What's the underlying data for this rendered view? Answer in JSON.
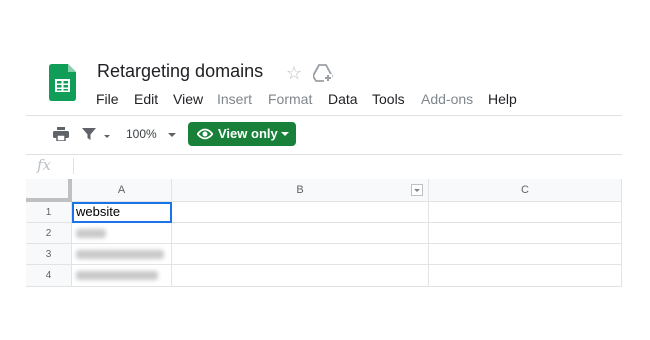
{
  "document": {
    "title": "Retargeting domains"
  },
  "icons": {
    "app": "sheets-logo-icon",
    "star": "star-outline-icon",
    "drive": "move-to-drive-icon"
  },
  "menu": {
    "items": [
      {
        "label": "File",
        "enabled": true
      },
      {
        "label": "Edit",
        "enabled": true
      },
      {
        "label": "View",
        "enabled": true
      },
      {
        "label": "Insert",
        "enabled": false
      },
      {
        "label": "Format",
        "enabled": false
      },
      {
        "label": "Data",
        "enabled": true
      },
      {
        "label": "Tools",
        "enabled": true
      },
      {
        "label": "Add-ons",
        "enabled": false
      },
      {
        "label": "Help",
        "enabled": true
      }
    ]
  },
  "toolbar": {
    "zoom": "100%",
    "mode_label": "View only",
    "print_icon": "print-icon",
    "filter_icon": "filter-icon",
    "eye_icon": "eye-icon"
  },
  "formula_bar": {
    "label": "fx",
    "value": ""
  },
  "grid": {
    "columns": [
      "A",
      "B",
      "C"
    ],
    "rows": [
      "1",
      "2",
      "3",
      "4"
    ],
    "cells": {
      "A1": "website"
    },
    "redacted_rows": [
      2,
      3,
      4
    ],
    "selected_cell": "A1"
  },
  "colors": {
    "accent_green": "#188038",
    "selection_blue": "#1a73e8",
    "sheets_green": "#0f9d58"
  }
}
